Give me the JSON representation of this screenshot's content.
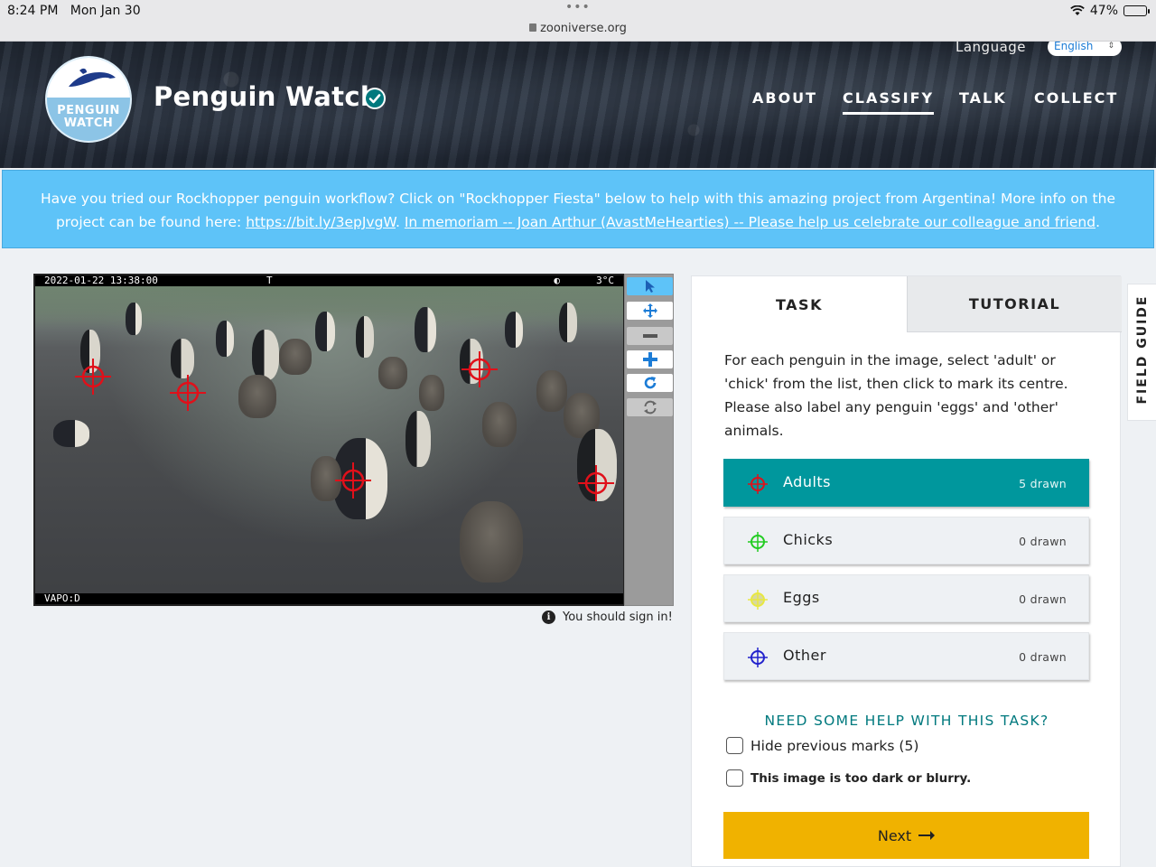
{
  "status_bar": {
    "time": "8:24 PM",
    "date": "Mon Jan 30",
    "url": "zooniverse.org",
    "battery": "47%",
    "battery_level": 0.47
  },
  "header": {
    "logo_line1": "PENGUIN",
    "logo_line2": "WATCH",
    "project_title": "Penguin Watch",
    "language_label": "Language",
    "language_value": "English",
    "nav": [
      "ABOUT",
      "CLASSIFY",
      "TALK",
      "COLLECT"
    ],
    "active_nav": "CLASSIFY"
  },
  "announcement": {
    "text": "Have you tried our Rockhopper penguin workflow? Click on \"Rockhopper Fiesta\" below to help with this amazing project from Argentina! More info on the project can be found here: ",
    "link1": "https://bit.ly/3epJvgW",
    "sep": ". ",
    "link2": "In memoriam -- Joan Arthur (AvastMeHearties) -- Please help us celebrate our colleague and friend",
    "end": "."
  },
  "subject": {
    "timestamp": "2022-01-22  13:38:00",
    "flag": "T",
    "temperature": "3°C",
    "camera_id": "VAPO:D",
    "mark_color": "#e0101a"
  },
  "toolbar": {
    "icons": [
      "pointer-icon",
      "move-icon",
      "zoom-out-icon",
      "zoom-in-icon",
      "rotate-icon",
      "reset-icon"
    ]
  },
  "signin_notice": "You should sign in!",
  "task_panel": {
    "tab_task": "TASK",
    "tab_tutorial": "TUTORIAL",
    "instructions": "For each penguin in the image, select 'adult' or 'chick' from the list, then click to mark its centre. Please also label any penguin 'eggs' and 'other' animals.",
    "choices": [
      {
        "label": "Adults",
        "count": "5 drawn",
        "color": "#e0101a"
      },
      {
        "label": "Chicks",
        "count": "0 drawn",
        "color": "#22cc22"
      },
      {
        "label": "Eggs",
        "count": "0 drawn",
        "color": "#e8e840"
      },
      {
        "label": "Other",
        "count": "0 drawn",
        "color": "#2222cc"
      }
    ],
    "help_link": "NEED SOME HELP WITH THIS TASK?",
    "hide_marks": "Hide previous marks (5)",
    "too_dark": "This image is too dark or blurry.",
    "next_button": "Next"
  },
  "field_guide": "FIELD GUIDE",
  "colors": {
    "accent_teal": "#00979d",
    "banner_blue": "#5ec3f8",
    "next_yellow": "#f0b200"
  }
}
